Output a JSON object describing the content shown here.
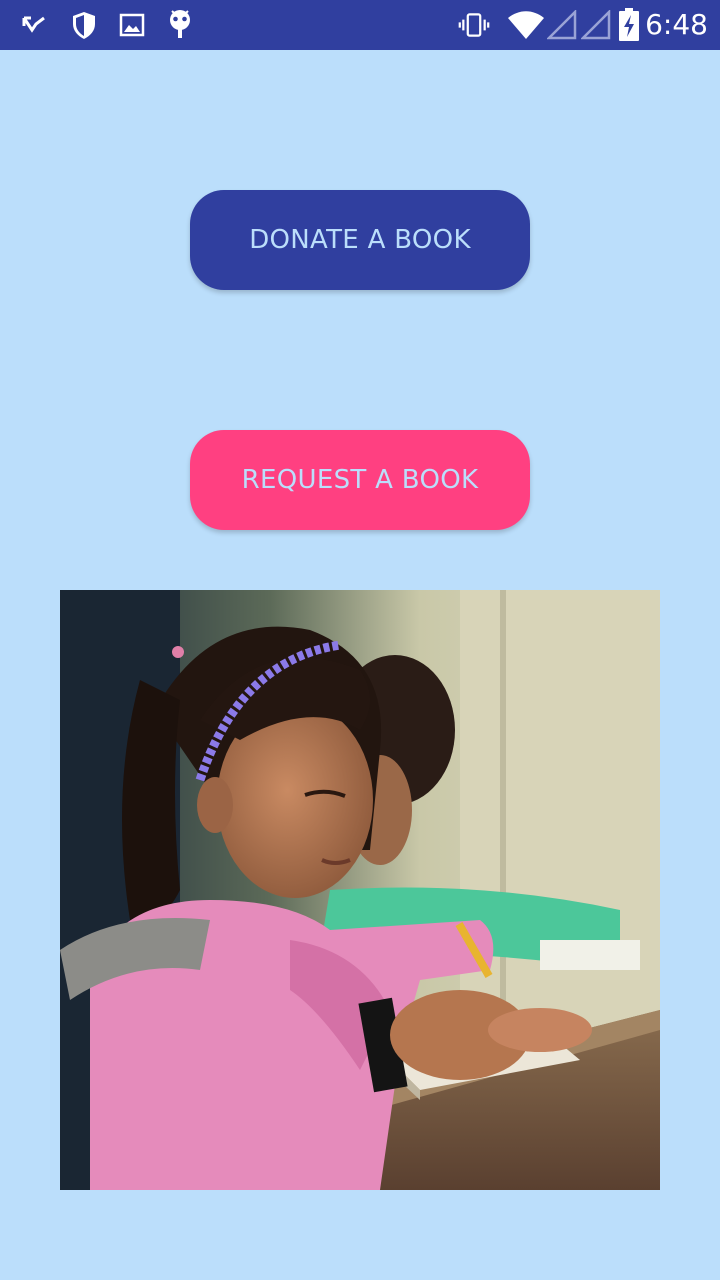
{
  "status_bar": {
    "time": "6:48",
    "icons": [
      "missed-call-icon",
      "shield-icon",
      "image-icon",
      "android-debug-icon",
      "vibrate-icon",
      "wifi-icon",
      "signal-icon",
      "signal-icon",
      "battery-charging-icon"
    ],
    "background_color": "#303f9f"
  },
  "main": {
    "background_color": "#bbdefb",
    "donate_button": {
      "label": "DONATE A BOOK",
      "color": "#303f9f"
    },
    "request_button": {
      "label": "REQUEST A BOOK",
      "color": "#ff4081"
    },
    "image": {
      "subject": "girl-writing-in-notebook-photo"
    }
  }
}
